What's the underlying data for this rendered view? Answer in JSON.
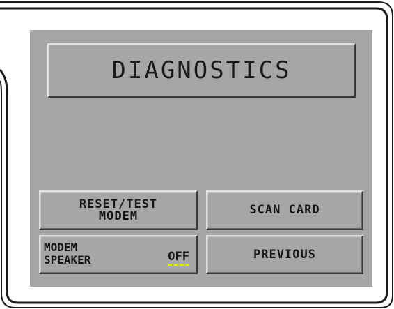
{
  "screen": {
    "title": "DIAGNOSTICS"
  },
  "buttons": {
    "reset_test_modem": "RESET/TEST\nMODEM",
    "reset_line1": "RESET/TEST",
    "reset_line2": "MODEM",
    "scan_card": "SCAN CARD",
    "modem_speaker_line1": "MODEM",
    "modem_speaker_line2": "SPEAKER",
    "modem_speaker_state": "OFF",
    "previous": "PREVIOUS"
  },
  "colors": {
    "screen_bg": "#a6a6a6",
    "bezel_outline": "#1a1a1a",
    "state_underline": "#e6e600"
  }
}
